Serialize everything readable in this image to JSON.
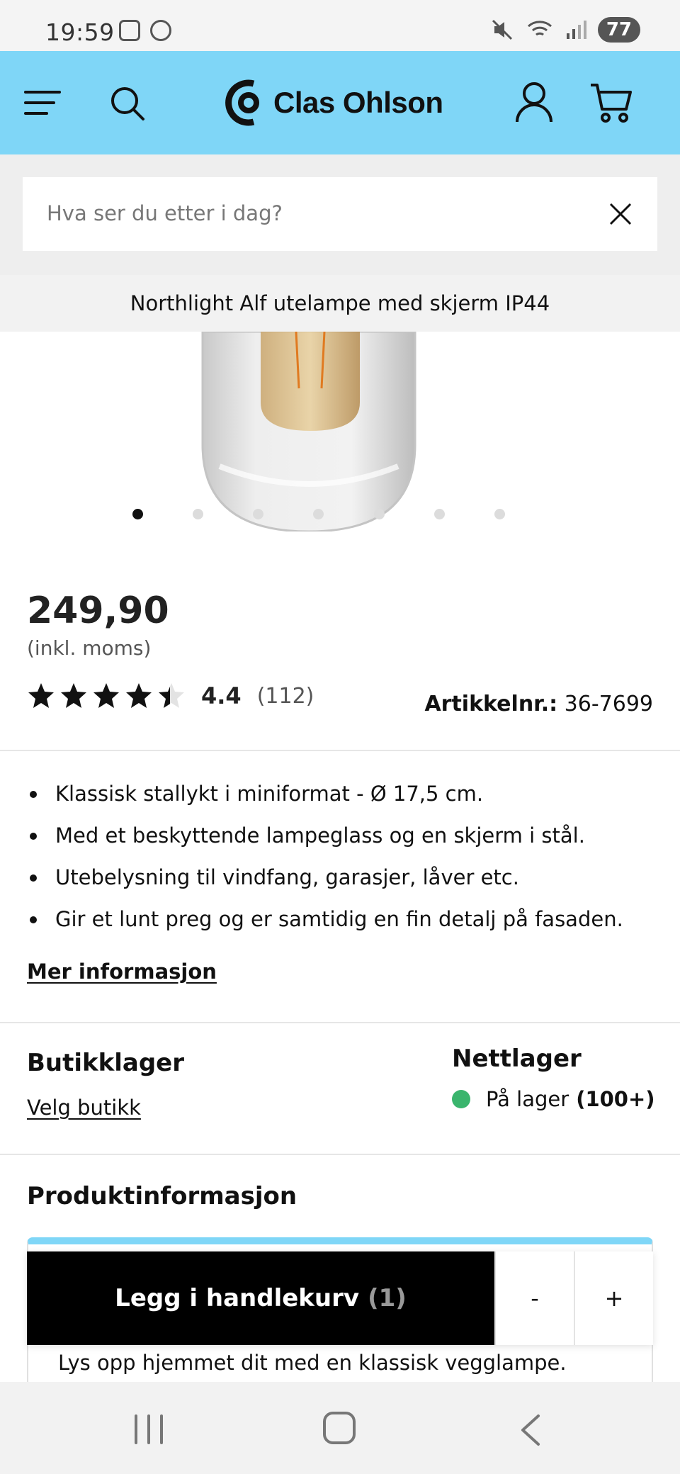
{
  "status_bar": {
    "time": "19:59",
    "battery": "77"
  },
  "header": {
    "logo_text": "Clas Ohlson",
    "brand_color": "#7fd6f7"
  },
  "search": {
    "placeholder": "Hva ser du etter i dag?"
  },
  "product": {
    "title": "Northlight Alf utelampe med skjerm IP44",
    "image_count": 7,
    "active_image": 1,
    "price": "249,90",
    "vat_note": "(inkl. moms)",
    "rating": {
      "value": "4.4",
      "count": "(112)",
      "stars_out_of": 5
    },
    "article": {
      "label": "Artikkelnr.:",
      "number": "36-7699"
    },
    "bullets": [
      "Klassisk stallykt i miniformat - Ø 17,5 cm.",
      "Med et beskyttende lampeglass og en skjerm i stål.",
      "Utebelysning til vindfang, garasjer, låver etc.",
      "Gir et lunt preg og er samtidig en fin detalj på fasaden."
    ],
    "more_info_label": "Mer informasjon"
  },
  "stock": {
    "store_title": "Butikklager",
    "store_link": "Velg butikk",
    "online_title": "Nettlager",
    "online_status": "På lager",
    "online_count": "(100+)",
    "status_color": "#3ab56d"
  },
  "product_info": {
    "title": "Produktinformasjon",
    "text": "Lys opp hjemmet dit med en klassisk vegglampe."
  },
  "cart": {
    "add_label": "Legg i handlekurv",
    "quantity": "(1)",
    "minus": "-",
    "plus": "+"
  }
}
